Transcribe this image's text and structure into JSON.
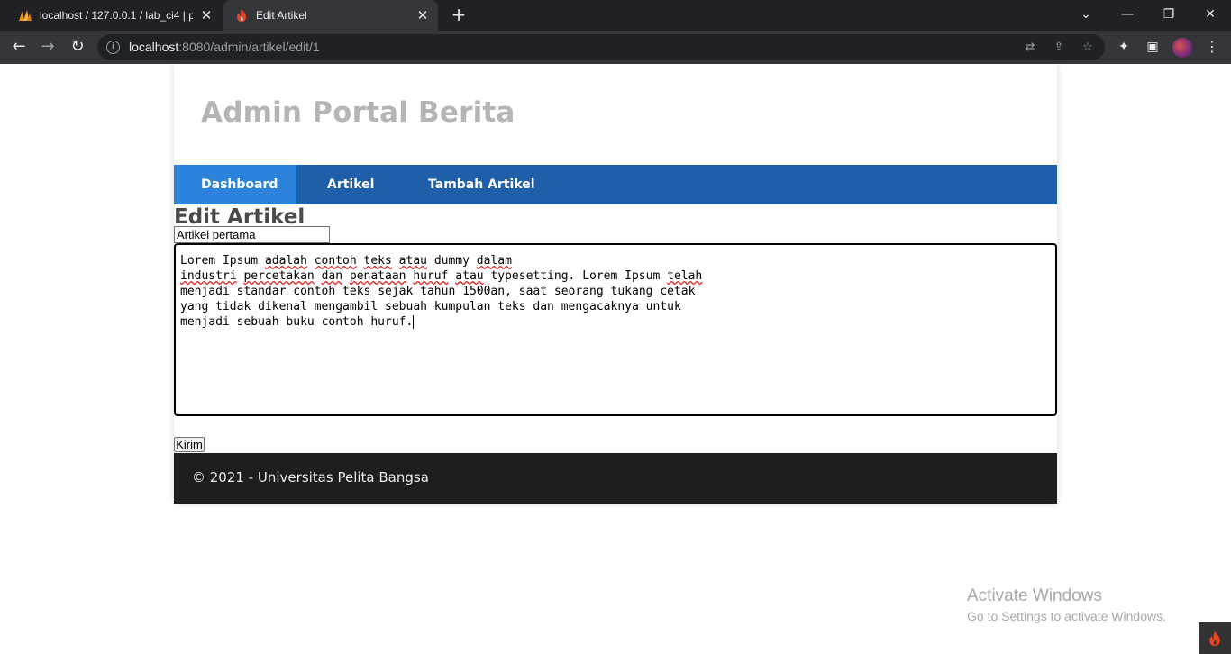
{
  "browser": {
    "tabs": [
      {
        "title": "localhost / 127.0.0.1 / lab_ci4 | phpMyAdmin",
        "icon": "phpmyadmin-icon",
        "active": false
      },
      {
        "title": "Edit Artikel",
        "icon": "codeigniter-icon",
        "active": true
      }
    ],
    "new_tab_glyph": "+",
    "address": {
      "host": "localhost",
      "path": ":8080/admin/artikel/edit/1"
    }
  },
  "site": {
    "title": "Admin Portal Berita"
  },
  "nav": {
    "items": [
      {
        "label": "Dashboard"
      },
      {
        "label": "Artikel"
      },
      {
        "label": "Tambah Artikel"
      }
    ]
  },
  "form": {
    "heading": "Edit Artikel",
    "title_value": "Artikel pertama",
    "content_value": "Lorem Ipsum adalah contoh teks atau dummy dalam\nindustri percetakan dan penataan huruf atau typesetting. Lorem Ipsum telah\nmenjadi standar contoh teks sejak tahun 1500an, saat seorang tukang cetak\nyang tidak dikenal mengambil sebuah kumpulan teks dan mengacaknya untuk\nmenjadi sebuah buku contoh huruf.",
    "submit_label": "Kirim"
  },
  "footer": {
    "text": "© 2021 - Universitas Pelita Bangsa"
  },
  "overlay": {
    "activate_title": "Activate Windows",
    "activate_sub": "Go to Settings to activate Windows."
  },
  "colors": {
    "nav_bg": "#1f5faa",
    "nav_active": "#2b83dc",
    "footer_bg": "#1e1e1e",
    "title_gray": "#b5b5b5"
  }
}
